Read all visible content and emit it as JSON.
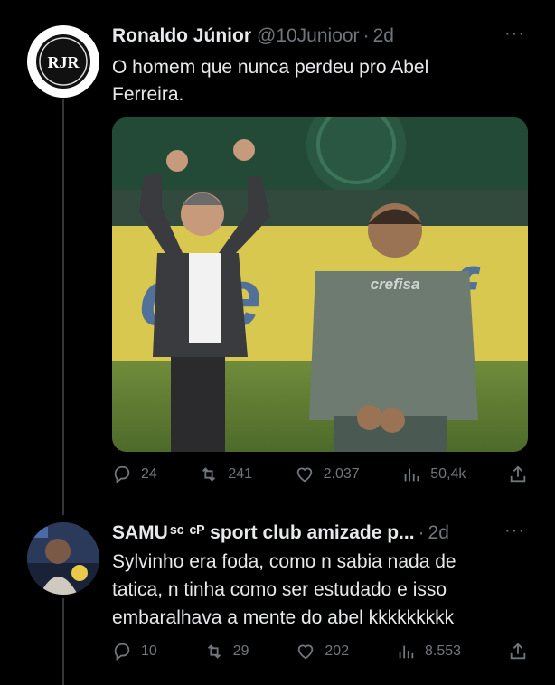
{
  "tweets": [
    {
      "author_name": "Ronaldo Júnior",
      "handle": "@10Junioor",
      "separator": "·",
      "time": "2d",
      "more": "···",
      "text": "O homem que nunca perdeu pro Abel Ferreira.",
      "avatar_text": "RJR",
      "media_text": "crefisa",
      "stats": {
        "replies": "24",
        "retweets": "241",
        "likes": "2.037",
        "views": "50,4k"
      }
    },
    {
      "author_name": "SAMU",
      "name_suffix": "ˢᶜ ᶜᴾ sport club amizade p...",
      "separator": "·",
      "time": "2d",
      "more": "···",
      "text": "Sylvinho era foda, como n sabia nada de tatica, n tinha como ser estudado e isso embaralhava a mente do abel kkkkkkkkk",
      "stats": {
        "replies": "10",
        "retweets": "29",
        "likes": "202",
        "views": "8.553"
      }
    }
  ],
  "icons": [
    "reply-icon",
    "retweet-icon",
    "like-icon",
    "views-icon",
    "share-icon",
    "more-icon"
  ],
  "colors": {
    "background": "#000000",
    "text": "#e7e9ea",
    "muted": "#71767b",
    "line": "#333639"
  }
}
